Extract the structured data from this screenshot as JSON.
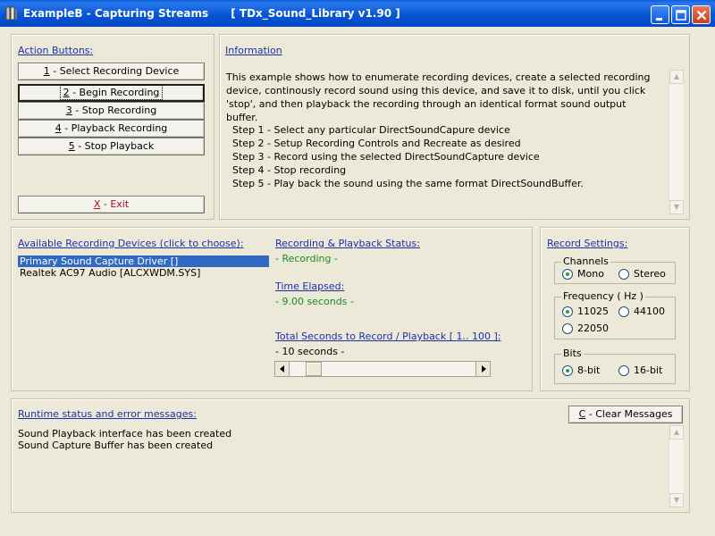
{
  "window": {
    "title": "ExampleB - Capturing Streams      [ TDx_Sound_Library v1.90 ]",
    "colors": {
      "titlebar": "#0756D6",
      "heading": "#1F2FA8",
      "status_green": "#1E8A1E",
      "selection": "#316AC5"
    }
  },
  "actions": {
    "heading": "Action Buttons:",
    "buttons": [
      {
        "key": "1",
        "rest": " - Select Recording Device"
      },
      {
        "key": "2",
        "rest": " - Begin Recording"
      },
      {
        "key": "3",
        "rest": " - Stop Recording"
      },
      {
        "key": "4",
        "rest": " - Playback Recording"
      },
      {
        "key": "5",
        "rest": " - Stop Playback"
      }
    ],
    "exit": {
      "key": "X",
      "rest": " - Exit"
    }
  },
  "info": {
    "heading": "Information",
    "paragraph": "This example shows how to enumerate recording devices, create a selected recording device, continously record sound using this device, and save it to disk, until you click 'stop', and then playback the recording through an identical format sound output buffer.",
    "steps": [
      "Step 1 - Select any particular DirectSoundCapure device",
      "Step 2 - Setup Recording Controls and Recreate as desired",
      "Step 3 - Record using the selected DirectSoundCapture device",
      "Step 4 - Stop recording",
      "Step 5 - Play back the sound using the same format DirectSoundBuffer."
    ]
  },
  "devices": {
    "heading": "Available Recording Devices (click to choose):",
    "items": [
      "Primary Sound Capture Driver []",
      "Realtek AC97 Audio [ALCXWDM.SYS]"
    ],
    "selected_index": 0
  },
  "status": {
    "heading": "Recording & Playback Status:",
    "value": "- Recording -",
    "time_heading": "Time Elapsed:",
    "time_value": "- 9.00 seconds -",
    "total_heading": "Total Seconds to Record / Playback [ 1.. 100 ]:",
    "total_value": "- 10 seconds -",
    "slider": {
      "min": 1,
      "max": 100,
      "value": 10
    }
  },
  "settings": {
    "heading": "Record Settings:",
    "channels": {
      "legend": "Channels",
      "options": [
        "Mono",
        "Stereo"
      ],
      "selected": "Mono"
    },
    "frequency": {
      "legend": "Frequency ( Hz )",
      "options": [
        "11025",
        "44100",
        "22050"
      ],
      "selected": "11025"
    },
    "bits": {
      "legend": "Bits",
      "options": [
        "8-bit",
        "16-bit"
      ],
      "selected": "8-bit"
    }
  },
  "runtime": {
    "heading": "Runtime status and error messages:",
    "clear_button": {
      "key": "C",
      "rest": " - Clear Messages"
    },
    "messages": [
      "Sound Playback interface has been created",
      "Sound Capture Buffer has been created"
    ]
  },
  "icons": [
    "app-icon",
    "minimize-icon",
    "maximize-icon",
    "close-icon",
    "scroll-up-icon",
    "scroll-down-icon",
    "slider-left-icon",
    "slider-right-icon"
  ]
}
